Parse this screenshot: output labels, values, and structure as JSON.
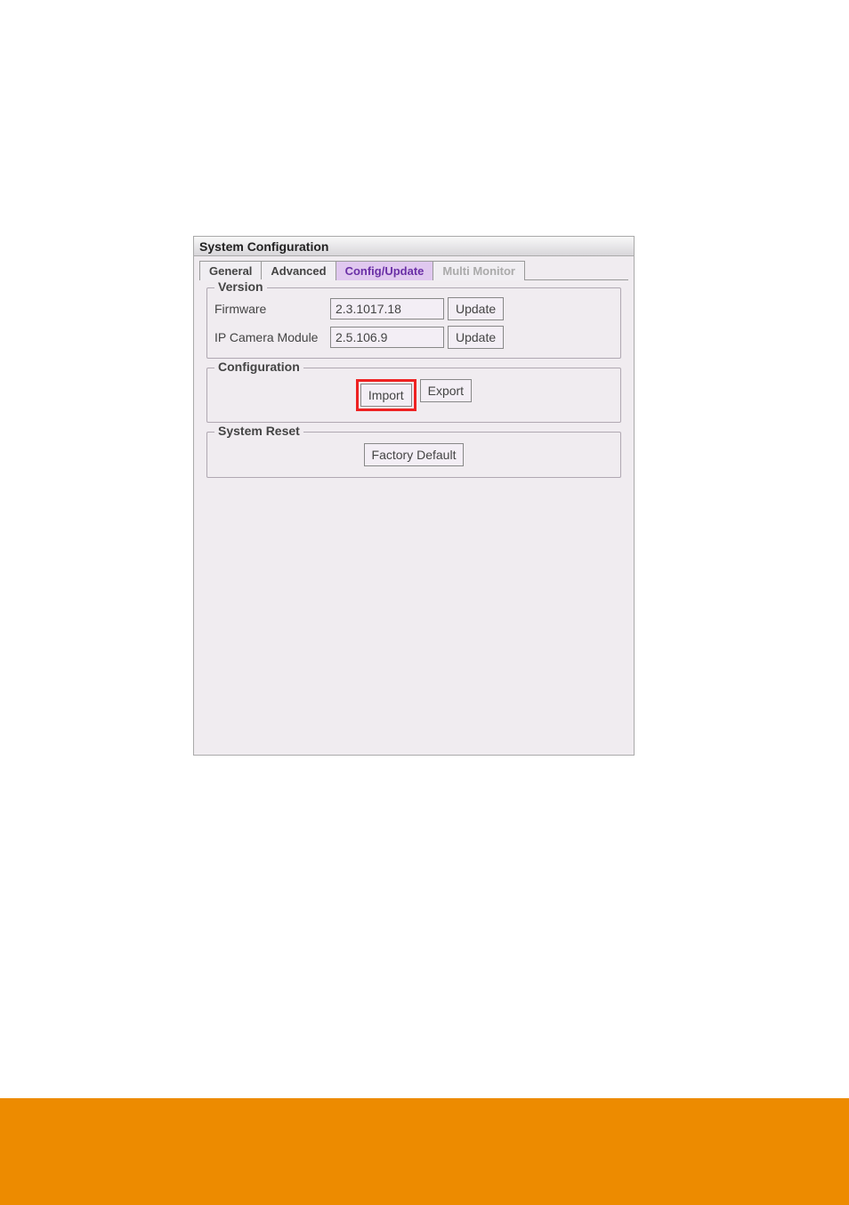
{
  "window": {
    "title": "System Configuration"
  },
  "tabs": {
    "general": "General",
    "advanced": "Advanced",
    "config_update": "Config/Update",
    "multi_monitor": "Multi Monitor"
  },
  "version": {
    "legend": "Version",
    "firmware_label": "Firmware",
    "firmware_value": "2.3.1017.18",
    "firmware_update": "Update",
    "ipcam_label": "IP Camera Module",
    "ipcam_value": "2.5.106.9",
    "ipcam_update": "Update"
  },
  "configuration": {
    "legend": "Configuration",
    "import": "Import",
    "export": "Export"
  },
  "system_reset": {
    "legend": "System Reset",
    "factory_default": "Factory Default"
  }
}
